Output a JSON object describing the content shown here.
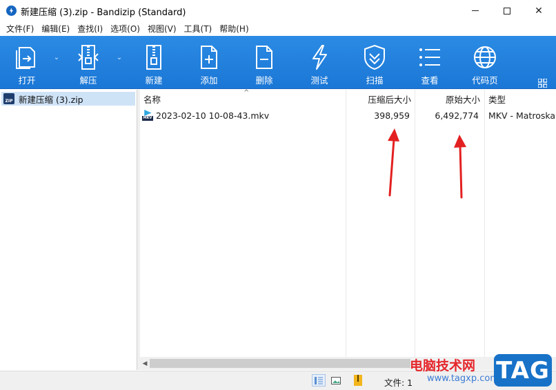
{
  "window": {
    "title": "新建压缩 (3).zip - Bandizip (Standard)",
    "controls": {
      "minimize": "—",
      "maximize": "☐",
      "close": "✕"
    }
  },
  "menu": [
    "文件(F)",
    "编辑(E)",
    "查找(I)",
    "选项(O)",
    "视图(V)",
    "工具(T)",
    "帮助(H)"
  ],
  "toolbar": [
    {
      "label": "打开",
      "icon": "open-icon",
      "has_dropdown": true
    },
    {
      "label": "解压",
      "icon": "extract-icon",
      "has_dropdown": true
    },
    {
      "label": "新建",
      "icon": "new-archive-icon",
      "has_dropdown": false
    },
    {
      "label": "添加",
      "icon": "add-file-icon",
      "has_dropdown": false
    },
    {
      "label": "删除",
      "icon": "delete-file-icon",
      "has_dropdown": false
    },
    {
      "label": "测试",
      "icon": "test-icon",
      "has_dropdown": false
    },
    {
      "label": "扫描",
      "icon": "scan-shield-icon",
      "has_dropdown": false
    },
    {
      "label": "查看",
      "icon": "view-list-icon",
      "has_dropdown": false
    },
    {
      "label": "代码页",
      "icon": "codepage-globe-icon",
      "has_dropdown": false
    }
  ],
  "tree": {
    "root": "新建压缩 (3).zip",
    "root_icon_text": "ZIP"
  },
  "columns": {
    "name": "名称",
    "compressed": "压缩后大小",
    "original": "原始大小",
    "type": "类型"
  },
  "files": [
    {
      "name": "2023-02-10 10-08-43.mkv",
      "icon_text": "MKV",
      "compressed": "398,959",
      "original": "6,492,774",
      "type": "MKV - Matroska"
    }
  ],
  "statusbar": {
    "text": "文件: 1"
  },
  "watermark": {
    "site_name": "电脑技术网",
    "url": "www.tagxp.com",
    "logo": "TAG"
  },
  "colors": {
    "toolbar": "#1b77d6",
    "selection": "#cfe3f7",
    "annotation_arrow": "#e32020"
  }
}
